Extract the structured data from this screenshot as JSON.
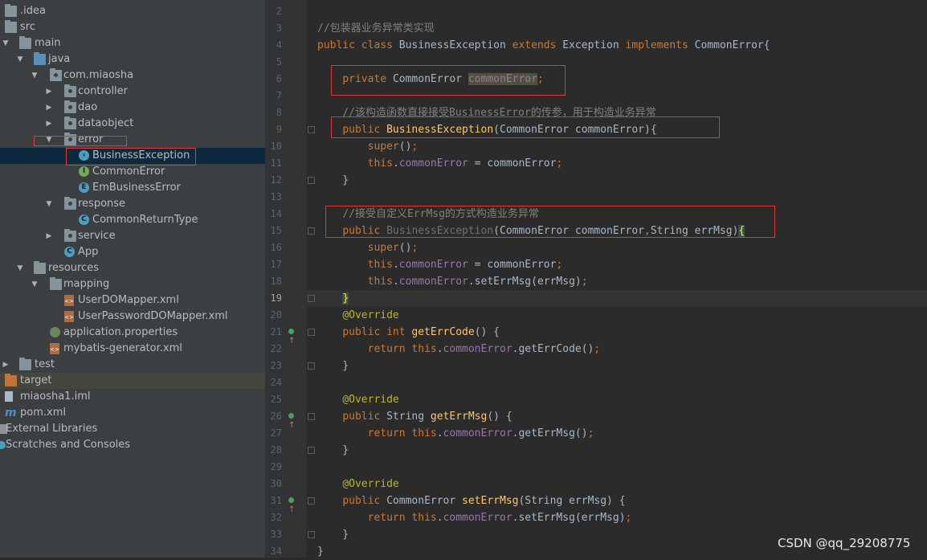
{
  "project_tree": [
    {
      "label": ".idea",
      "icon": "folder-icon",
      "arrow": "",
      "indent": 0
    },
    {
      "label": "src",
      "icon": "folder-icon",
      "arrow": "",
      "indent": 0
    },
    {
      "label": "main",
      "icon": "folder-icon",
      "arrow": "down",
      "indent": 0
    },
    {
      "label": "java",
      "icon": "source-folder-icon",
      "arrow": "down",
      "indent": 1
    },
    {
      "label": "com.miaosha",
      "icon": "package-icon",
      "arrow": "down",
      "indent": 2
    },
    {
      "label": "controller",
      "icon": "package-icon",
      "arrow": "right",
      "indent": 3
    },
    {
      "label": "dao",
      "icon": "package-icon",
      "arrow": "right",
      "indent": 3
    },
    {
      "label": "dataobject",
      "icon": "package-icon",
      "arrow": "right",
      "indent": 3
    },
    {
      "label": "error",
      "icon": "package-icon",
      "arrow": "down",
      "indent": 3
    },
    {
      "label": "BusinessException",
      "icon": "exception-class-icon",
      "arrow": "",
      "indent": 4,
      "selected": true
    },
    {
      "label": "CommonError",
      "icon": "interface-icon",
      "arrow": "",
      "indent": 4
    },
    {
      "label": "EmBusinessError",
      "icon": "enum-icon",
      "arrow": "",
      "indent": 4
    },
    {
      "label": "response",
      "icon": "package-icon",
      "arrow": "down",
      "indent": 3
    },
    {
      "label": "CommonReturnType",
      "icon": "class-icon",
      "arrow": "",
      "indent": 4
    },
    {
      "label": "service",
      "icon": "package-icon",
      "arrow": "right",
      "indent": 3
    },
    {
      "label": "App",
      "icon": "main-class-icon",
      "arrow": "",
      "indent": 3
    },
    {
      "label": "resources",
      "icon": "resources-folder-icon",
      "arrow": "down",
      "indent": 1
    },
    {
      "label": "mapping",
      "icon": "folder-icon",
      "arrow": "down",
      "indent": 2
    },
    {
      "label": "UserDOMapper.xml",
      "icon": "xml-file-icon",
      "arrow": "",
      "indent": 3
    },
    {
      "label": "UserPasswordDOMapper.xml",
      "icon": "xml-file-icon",
      "arrow": "",
      "indent": 3
    },
    {
      "label": "application.properties",
      "icon": "properties-file-icon",
      "arrow": "",
      "indent": 2
    },
    {
      "label": "mybatis-generator.xml",
      "icon": "xml-file-icon",
      "arrow": "",
      "indent": 2
    },
    {
      "label": "test",
      "icon": "folder-icon",
      "arrow": "right",
      "indent": 0
    },
    {
      "label": "target",
      "icon": "excluded-folder-icon",
      "arrow": "",
      "indent": 0,
      "highlight": true
    },
    {
      "label": "miaosha1.iml",
      "icon": "iml-file-icon",
      "arrow": "",
      "indent": 0
    },
    {
      "label": "pom.xml",
      "icon": "maven-icon",
      "arrow": "",
      "indent": 0
    },
    {
      "label": "External Libraries",
      "icon": "libraries-icon",
      "arrow": "",
      "indent": 0
    },
    {
      "label": "Scratches and Consoles",
      "icon": "scratches-icon",
      "arrow": "",
      "indent": 0
    }
  ],
  "editor": {
    "current_line": 19,
    "lines": [
      {
        "n": "2",
        "s": []
      },
      {
        "n": "3",
        "s": [
          [
            "cm",
            "//包装器业务异常类实现"
          ]
        ]
      },
      {
        "n": "4",
        "s": [
          [
            "kw",
            "public class "
          ],
          [
            "",
            "BusinessException "
          ],
          [
            "kw",
            "extends "
          ],
          [
            "",
            "Exception "
          ],
          [
            "kw",
            "implements "
          ],
          [
            "",
            "CommonError{"
          ]
        ]
      },
      {
        "n": "5",
        "s": []
      },
      {
        "n": "6",
        "s": [
          [
            "",
            "    "
          ],
          [
            "kw",
            "private "
          ],
          [
            "",
            "CommonError "
          ],
          [
            "fld-hl",
            "commonError"
          ],
          [
            "kw",
            ";"
          ]
        ]
      },
      {
        "n": "7",
        "s": []
      },
      {
        "n": "8",
        "s": [
          [
            "",
            "    "
          ],
          [
            "cm",
            "//该构造函数直接接受BusinessError的传参，用于构造业务异常"
          ]
        ]
      },
      {
        "n": "9",
        "s": [
          [
            "",
            "    "
          ],
          [
            "kw",
            "public "
          ],
          [
            "fn",
            "BusinessException"
          ],
          [
            "",
            "(CommonError commonError){"
          ]
        ]
      },
      {
        "n": "10",
        "s": [
          [
            "",
            "        "
          ],
          [
            "kw",
            "super"
          ],
          [
            "",
            "()"
          ],
          [
            "kw",
            ";"
          ]
        ]
      },
      {
        "n": "11",
        "s": [
          [
            "",
            "        "
          ],
          [
            "kw",
            "this"
          ],
          [
            "",
            "."
          ],
          [
            "fld",
            "commonError"
          ],
          [
            "",
            " = commonError"
          ],
          [
            "kw",
            ";"
          ]
        ]
      },
      {
        "n": "12",
        "s": [
          [
            "",
            "    }"
          ]
        ]
      },
      {
        "n": "13",
        "s": []
      },
      {
        "n": "14",
        "s": [
          [
            "",
            "    "
          ],
          [
            "cm",
            "//接受自定义ErrMsg的方式构造业务异常"
          ]
        ]
      },
      {
        "n": "15",
        "s": [
          [
            "",
            "    "
          ],
          [
            "kw",
            "public "
          ],
          [
            "dim",
            "BusinessException"
          ],
          [
            "",
            "(CommonError commonError"
          ],
          [
            "kw",
            ","
          ],
          [
            "",
            "String errMsg)"
          ],
          [
            "brace-hl",
            "{"
          ]
        ]
      },
      {
        "n": "16",
        "s": [
          [
            "",
            "        "
          ],
          [
            "kw",
            "super"
          ],
          [
            "",
            "()"
          ],
          [
            "kw",
            ";"
          ]
        ]
      },
      {
        "n": "17",
        "s": [
          [
            "",
            "        "
          ],
          [
            "kw",
            "this"
          ],
          [
            "",
            "."
          ],
          [
            "fld",
            "commonError"
          ],
          [
            "",
            " = commonError"
          ],
          [
            "kw",
            ";"
          ]
        ]
      },
      {
        "n": "18",
        "s": [
          [
            "",
            "        "
          ],
          [
            "kw",
            "this"
          ],
          [
            "",
            "."
          ],
          [
            "fld",
            "commonError"
          ],
          [
            "",
            ".setErrMsg(errMsg)"
          ],
          [
            "kw",
            ";"
          ]
        ]
      },
      {
        "n": "19",
        "s": [
          [
            "",
            "    "
          ],
          [
            "brace-hl",
            "}"
          ]
        ]
      },
      {
        "n": "20",
        "s": [
          [
            "",
            "    "
          ],
          [
            "an",
            "@Override"
          ]
        ]
      },
      {
        "n": "21",
        "s": [
          [
            "",
            "    "
          ],
          [
            "kw",
            "public int "
          ],
          [
            "fn",
            "getErrCode"
          ],
          [
            "",
            "() {"
          ]
        ],
        "override": true
      },
      {
        "n": "22",
        "s": [
          [
            "",
            "        "
          ],
          [
            "kw",
            "return this"
          ],
          [
            "",
            "."
          ],
          [
            "fld",
            "commonError"
          ],
          [
            "",
            ".getErrCode()"
          ],
          [
            "kw",
            ";"
          ]
        ]
      },
      {
        "n": "23",
        "s": [
          [
            "",
            "    }"
          ]
        ]
      },
      {
        "n": "24",
        "s": []
      },
      {
        "n": "25",
        "s": [
          [
            "",
            "    "
          ],
          [
            "an",
            "@Override"
          ]
        ]
      },
      {
        "n": "26",
        "s": [
          [
            "",
            "    "
          ],
          [
            "kw",
            "public "
          ],
          [
            "",
            "String "
          ],
          [
            "fn",
            "getErrMsg"
          ],
          [
            "",
            "() {"
          ]
        ],
        "override": true
      },
      {
        "n": "27",
        "s": [
          [
            "",
            "        "
          ],
          [
            "kw",
            "return this"
          ],
          [
            "",
            "."
          ],
          [
            "fld",
            "commonError"
          ],
          [
            "",
            ".getErrMsg()"
          ],
          [
            "kw",
            ";"
          ]
        ]
      },
      {
        "n": "28",
        "s": [
          [
            "",
            "    }"
          ]
        ]
      },
      {
        "n": "29",
        "s": []
      },
      {
        "n": "30",
        "s": [
          [
            "",
            "    "
          ],
          [
            "an",
            "@Override"
          ]
        ]
      },
      {
        "n": "31",
        "s": [
          [
            "",
            "    "
          ],
          [
            "kw",
            "public "
          ],
          [
            "",
            "CommonError "
          ],
          [
            "fn",
            "setErrMsg"
          ],
          [
            "",
            "(String errMsg) {"
          ]
        ],
        "override": true
      },
      {
        "n": "32",
        "s": [
          [
            "",
            "        "
          ],
          [
            "kw",
            "return this"
          ],
          [
            "",
            "."
          ],
          [
            "fld",
            "commonError"
          ],
          [
            "",
            ".setErrMsg(errMsg)"
          ],
          [
            "kw",
            ";"
          ]
        ]
      },
      {
        "n": "33",
        "s": [
          [
            "",
            "    }"
          ]
        ]
      },
      {
        "n": "34",
        "s": [
          [
            "",
            "}"
          ]
        ]
      }
    ]
  },
  "watermark": "CSDN @qq_29208775"
}
